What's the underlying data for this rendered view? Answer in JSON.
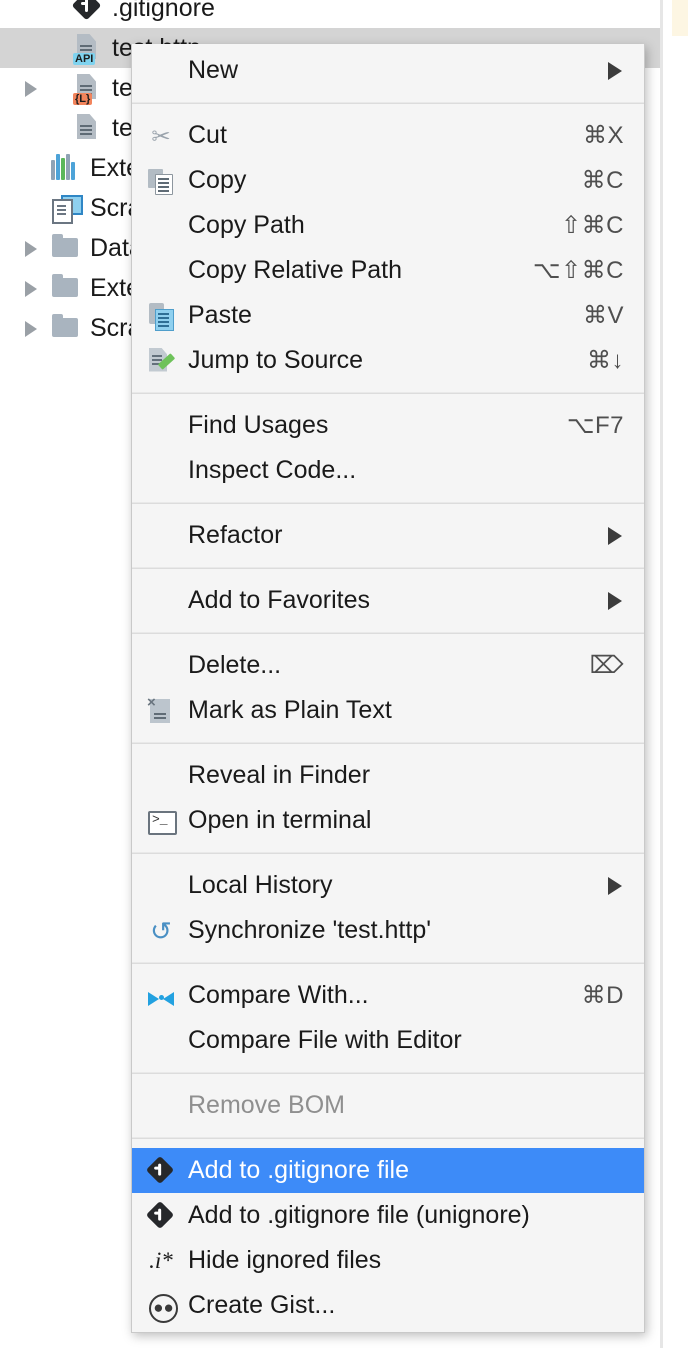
{
  "app": {
    "theme_accent": "#3d8bf8",
    "menu_bg": "#f5f5f5",
    "selected_row_bg": "#d4d4d4"
  },
  "project_tree": {
    "items": [
      {
        "label": ".gitignore",
        "icon": "git-file-icon",
        "indent": 1,
        "expandable": false,
        "selected": false,
        "badge": ""
      },
      {
        "label": "test.http",
        "icon": "http-file-icon",
        "indent": 1,
        "expandable": false,
        "selected": true,
        "badge": "API"
      },
      {
        "label": "test.less",
        "icon": "less-file-icon",
        "indent": 1,
        "expandable": true,
        "selected": false,
        "badge": "{L}"
      },
      {
        "label": "test-todo.txt",
        "icon": "text-file-icon",
        "indent": 1,
        "expandable": false,
        "selected": false,
        "badge": ""
      },
      {
        "label": "External Libraries",
        "icon": "libraries-icon",
        "indent": 0,
        "expandable": false,
        "selected": false,
        "badge": ""
      },
      {
        "label": "Scratches and Consoles",
        "icon": "scratches-icon",
        "indent": 0,
        "expandable": false,
        "selected": false,
        "badge": ""
      },
      {
        "label": "Database Consoles",
        "icon": "folder-icon",
        "indent": 0,
        "expandable": true,
        "selected": false,
        "badge": ""
      },
      {
        "label": "Extensions",
        "icon": "folder-icon",
        "indent": 0,
        "expandable": true,
        "selected": false,
        "badge": ""
      },
      {
        "label": "Scratches",
        "icon": "folder-icon",
        "indent": 0,
        "expandable": true,
        "selected": false,
        "badge": ""
      }
    ]
  },
  "context_menu": {
    "groups": [
      {
        "items": [
          {
            "label": "New",
            "shortcut": "",
            "icon": "",
            "submenu": true,
            "selected": false,
            "disabled": false
          }
        ]
      },
      {
        "items": [
          {
            "label": "Cut",
            "shortcut": "⌘X",
            "icon": "scissors-icon",
            "submenu": false,
            "selected": false,
            "disabled": false
          },
          {
            "label": "Copy",
            "shortcut": "⌘C",
            "icon": "copy-icon",
            "submenu": false,
            "selected": false,
            "disabled": false
          },
          {
            "label": "Copy Path",
            "shortcut": "⇧⌘C",
            "icon": "",
            "submenu": false,
            "selected": false,
            "disabled": false
          },
          {
            "label": "Copy Relative Path",
            "shortcut": "⌥⇧⌘C",
            "icon": "",
            "submenu": false,
            "selected": false,
            "disabled": false
          },
          {
            "label": "Paste",
            "shortcut": "⌘V",
            "icon": "paste-icon",
            "submenu": false,
            "selected": false,
            "disabled": false
          },
          {
            "label": "Jump to Source",
            "shortcut": "⌘↓",
            "icon": "jump-to-source-icon",
            "submenu": false,
            "selected": false,
            "disabled": false
          }
        ]
      },
      {
        "items": [
          {
            "label": "Find Usages",
            "shortcut": "⌥F7",
            "icon": "",
            "submenu": false,
            "selected": false,
            "disabled": false
          },
          {
            "label": "Inspect Code...",
            "shortcut": "",
            "icon": "",
            "submenu": false,
            "selected": false,
            "disabled": false
          }
        ]
      },
      {
        "items": [
          {
            "label": "Refactor",
            "shortcut": "",
            "icon": "",
            "submenu": true,
            "selected": false,
            "disabled": false
          }
        ]
      },
      {
        "items": [
          {
            "label": "Add to Favorites",
            "shortcut": "",
            "icon": "",
            "submenu": true,
            "selected": false,
            "disabled": false
          }
        ]
      },
      {
        "items": [
          {
            "label": "Delete...",
            "shortcut": "⌦",
            "icon": "",
            "submenu": false,
            "selected": false,
            "disabled": false
          },
          {
            "label": "Mark as Plain Text",
            "shortcut": "",
            "icon": "mark-as-plain-text-icon",
            "submenu": false,
            "selected": false,
            "disabled": false
          }
        ]
      },
      {
        "items": [
          {
            "label": "Reveal in Finder",
            "shortcut": "",
            "icon": "",
            "submenu": false,
            "selected": false,
            "disabled": false
          },
          {
            "label": "Open in terminal",
            "shortcut": "",
            "icon": "terminal-icon",
            "submenu": false,
            "selected": false,
            "disabled": false
          }
        ]
      },
      {
        "items": [
          {
            "label": "Local History",
            "shortcut": "",
            "icon": "",
            "submenu": true,
            "selected": false,
            "disabled": false
          },
          {
            "label": "Synchronize 'test.http'",
            "shortcut": "",
            "icon": "synchronize-icon",
            "submenu": false,
            "selected": false,
            "disabled": false
          }
        ]
      },
      {
        "items": [
          {
            "label": "Compare With...",
            "shortcut": "⌘D",
            "icon": "compare-icon",
            "submenu": false,
            "selected": false,
            "disabled": false
          },
          {
            "label": "Compare File with Editor",
            "shortcut": "",
            "icon": "",
            "submenu": false,
            "selected": false,
            "disabled": false
          }
        ]
      },
      {
        "items": [
          {
            "label": "Remove BOM",
            "shortcut": "",
            "icon": "",
            "submenu": false,
            "selected": false,
            "disabled": true
          }
        ]
      },
      {
        "items": [
          {
            "label": "Add to .gitignore file",
            "shortcut": "",
            "icon": "git-icon",
            "submenu": false,
            "selected": true,
            "disabled": false
          },
          {
            "label": "Add to .gitignore file (unignore)",
            "shortcut": "",
            "icon": "git-icon",
            "submenu": false,
            "selected": false,
            "disabled": false
          },
          {
            "label": "Hide ignored files",
            "shortcut": "",
            "icon": "ignore-pattern-icon",
            "submenu": false,
            "selected": false,
            "disabled": false
          },
          {
            "label": "Create Gist...",
            "shortcut": "",
            "icon": "github-icon",
            "submenu": false,
            "selected": false,
            "disabled": false
          }
        ]
      }
    ]
  }
}
